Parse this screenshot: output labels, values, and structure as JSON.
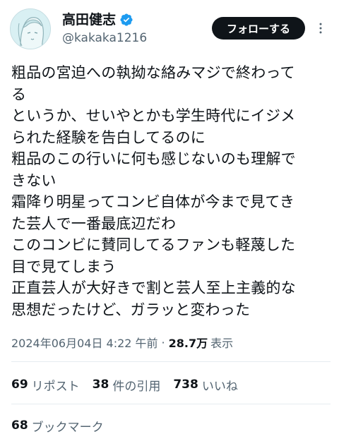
{
  "user": {
    "display_name": "高田健志",
    "handle": "@kakaka1216",
    "verified_icon": "verified-badge-icon",
    "avatar_icon": "user-avatar"
  },
  "header": {
    "follow_label": "フォローする",
    "more_icon": "more-options-icon"
  },
  "tweet": {
    "lines": [
      "粗品の宮迫への執拗な絡みマジで終わって",
      "る",
      "というか、せいやとかも学生時代にイジメ",
      "られた経験を告白してるのに",
      "粗品のこの行いに何も感じないのも理解で",
      "きない",
      "霜降り明星ってコンビ自体が今まで見てき",
      "た芸人で一番最底辺だわ",
      "このコンビに賛同してるファンも軽蔑した",
      "目で見てしまう",
      "正直芸人が大好きで割と芸人至上主義的な",
      "思想だったけど、ガラッと変わった"
    ]
  },
  "meta": {
    "timestamp": "2024年06月04日 4:22 午前",
    "separator": "·",
    "views_count": "28.7万",
    "views_label": "表示"
  },
  "stats": {
    "reposts": {
      "count": "69",
      "label": "リポスト"
    },
    "quotes": {
      "count": "38",
      "label": "件の引用"
    },
    "likes": {
      "count": "738",
      "label": "いいね"
    },
    "bookmarks": {
      "count": "68",
      "label": "ブックマーク"
    }
  },
  "colors": {
    "text_primary": "#0f1419",
    "text_secondary": "#536471",
    "verified_blue": "#1d9bf0",
    "button_bg": "#0f1419",
    "divider": "#e6ecf0"
  }
}
